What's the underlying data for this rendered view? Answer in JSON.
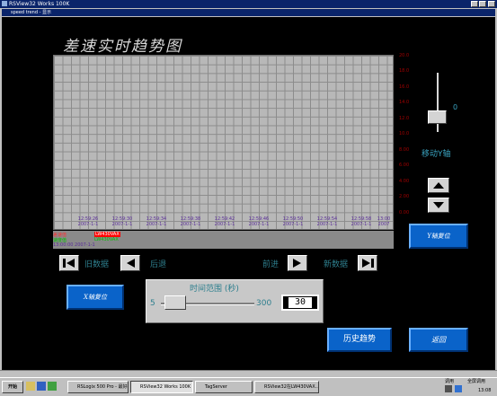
{
  "outer_window": {
    "title": "RSView32 Works 100K"
  },
  "inner_window": {
    "title": "speed trend - 显示"
  },
  "display": {
    "title": "差速实时趋势图",
    "y_axis_ticks": [
      "20.0",
      "18.0",
      "16.0",
      "14.0",
      "12.0",
      "10.0",
      "8.00",
      "6.00",
      "4.00",
      "2.00",
      "0.00"
    ],
    "x_axis_ticks": [
      {
        "time": "12:59:26",
        "date": "2007-1-1"
      },
      {
        "time": "12:59:30",
        "date": "2007-1-1"
      },
      {
        "time": "12:59:34",
        "date": "2007-1-1"
      },
      {
        "time": "12:59:38",
        "date": "2007-1-1"
      },
      {
        "time": "12:59:42",
        "date": "2007-1-1"
      },
      {
        "time": "12:59:46",
        "date": "2007-1-1"
      },
      {
        "time": "12:59:50",
        "date": "2007-1-1"
      },
      {
        "time": "12:59:54",
        "date": "2007-1-1"
      },
      {
        "time": "12:59:58",
        "date": "2007-1-1"
      },
      {
        "time": "13:00",
        "date": "2007"
      }
    ],
    "legend": {
      "row1_name": "差速值",
      "row1_tag": "LW430VAX",
      "row2_name": "速度值",
      "row2_tag": "LW430VAX",
      "row3_text": "13:00:00    2007-1-1"
    },
    "nav": {
      "old_data": "旧数据",
      "back": "后退",
      "forward": "前进",
      "new_data": "新数据"
    },
    "y_slider": {
      "value": "0",
      "label": "移动Y轴"
    },
    "y_reset_button": "Y轴复位",
    "x_reset_button": "X轴复位",
    "time_range": {
      "label": "时间范围 (秒)",
      "min": "5",
      "max": "300",
      "value": "30"
    },
    "history_button": "历史趋势",
    "return_button": "返回"
  },
  "taskbar": {
    "start": "开始",
    "tasks": [
      "RSLogix 500 Pro - 最好程...",
      "RSView32 Works 100K",
      "TagServer",
      "RSView32在LW430VAX..."
    ],
    "tray_items": [
      "调用",
      "全屏调用",
      "13:08"
    ]
  },
  "colors": {
    "background": "#000000",
    "plot_bg": "#b8b8b8",
    "button_blue": "#0a63c9",
    "y_tick": "#a00000",
    "x_tick": "#5a2e99",
    "teal_text": "#2e7f8e"
  }
}
